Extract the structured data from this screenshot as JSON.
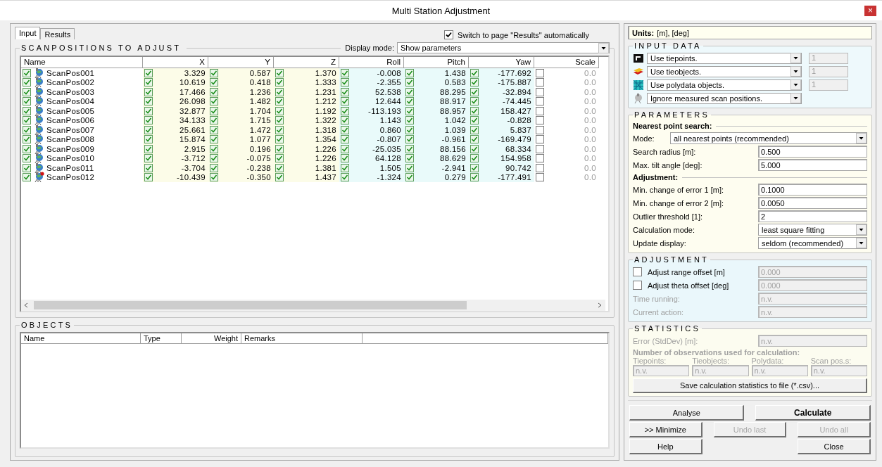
{
  "window": {
    "title": "Multi Station Adjustment",
    "close": "×"
  },
  "tabs": [
    {
      "label": "Input",
      "selected": true
    },
    {
      "label": "Results",
      "selected": false
    }
  ],
  "auto_switch": {
    "label": "Switch to page \"Results\" automatically",
    "checked": true
  },
  "scanpositions": {
    "title": "SCANPOSITIONS TO ADJUST",
    "display_mode": {
      "label": "Display mode:",
      "value": "Show parameters"
    },
    "columns": [
      "Name",
      "X",
      "Y",
      "Z",
      "Roll",
      "Pitch",
      "Yaw",
      "Scale"
    ],
    "rows": [
      {
        "cells": [
          {
            "checked": true,
            "kind": "normal",
            "value": "ScanPos001"
          },
          {
            "checked": true,
            "value": "3.329"
          },
          {
            "checked": true,
            "value": "0.587"
          },
          {
            "checked": true,
            "value": "1.370"
          },
          {
            "checked": true,
            "value": "-0.008"
          },
          {
            "checked": true,
            "value": "1.438"
          },
          {
            "checked": true,
            "value": "-177.692"
          },
          {
            "checked": false,
            "value": "0.0"
          }
        ]
      },
      {
        "cells": [
          {
            "checked": true,
            "kind": "normal",
            "value": "ScanPos002"
          },
          {
            "checked": true,
            "value": "10.619"
          },
          {
            "checked": true,
            "value": "0.418"
          },
          {
            "checked": true,
            "value": "1.333"
          },
          {
            "checked": true,
            "value": "-2.355"
          },
          {
            "checked": true,
            "value": "0.583"
          },
          {
            "checked": true,
            "value": "-175.887"
          },
          {
            "checked": false,
            "value": "0.0"
          }
        ]
      },
      {
        "cells": [
          {
            "checked": true,
            "kind": "normal",
            "value": "ScanPos003"
          },
          {
            "checked": true,
            "value": "17.466"
          },
          {
            "checked": true,
            "value": "1.236"
          },
          {
            "checked": true,
            "value": "1.231"
          },
          {
            "checked": true,
            "value": "52.538"
          },
          {
            "checked": true,
            "value": "88.295"
          },
          {
            "checked": true,
            "value": "-32.894"
          },
          {
            "checked": false,
            "value": "0.0"
          }
        ]
      },
      {
        "cells": [
          {
            "checked": true,
            "kind": "normal",
            "value": "ScanPos004"
          },
          {
            "checked": true,
            "value": "26.098"
          },
          {
            "checked": true,
            "value": "1.482"
          },
          {
            "checked": true,
            "value": "1.212"
          },
          {
            "checked": true,
            "value": "12.644"
          },
          {
            "checked": true,
            "value": "88.917"
          },
          {
            "checked": true,
            "value": "-74.445"
          },
          {
            "checked": false,
            "value": "0.0"
          }
        ]
      },
      {
        "cells": [
          {
            "checked": true,
            "kind": "normal",
            "value": "ScanPos005"
          },
          {
            "checked": true,
            "value": "32.877"
          },
          {
            "checked": true,
            "value": "1.704"
          },
          {
            "checked": true,
            "value": "1.192"
          },
          {
            "checked": true,
            "value": "-113.193"
          },
          {
            "checked": true,
            "value": "88.957"
          },
          {
            "checked": true,
            "value": "158.427"
          },
          {
            "checked": false,
            "value": "0.0"
          }
        ]
      },
      {
        "cells": [
          {
            "checked": true,
            "kind": "normal",
            "value": "ScanPos006"
          },
          {
            "checked": true,
            "value": "34.133"
          },
          {
            "checked": true,
            "value": "1.715"
          },
          {
            "checked": true,
            "value": "1.322"
          },
          {
            "checked": true,
            "value": "1.143"
          },
          {
            "checked": true,
            "value": "1.042"
          },
          {
            "checked": true,
            "value": "-0.828"
          },
          {
            "checked": false,
            "value": "0.0"
          }
        ]
      },
      {
        "cells": [
          {
            "checked": true,
            "kind": "normal",
            "value": "ScanPos007"
          },
          {
            "checked": true,
            "value": "25.661"
          },
          {
            "checked": true,
            "value": "1.472"
          },
          {
            "checked": true,
            "value": "1.318"
          },
          {
            "checked": true,
            "value": "0.860"
          },
          {
            "checked": true,
            "value": "1.039"
          },
          {
            "checked": true,
            "value": "5.837"
          },
          {
            "checked": false,
            "value": "0.0"
          }
        ]
      },
      {
        "cells": [
          {
            "checked": true,
            "kind": "normal",
            "value": "ScanPos008"
          },
          {
            "checked": true,
            "value": "15.874"
          },
          {
            "checked": true,
            "value": "1.077"
          },
          {
            "checked": true,
            "value": "1.354"
          },
          {
            "checked": true,
            "value": "-0.807"
          },
          {
            "checked": true,
            "value": "-0.961"
          },
          {
            "checked": true,
            "value": "-169.479"
          },
          {
            "checked": false,
            "value": "0.0"
          }
        ]
      },
      {
        "cells": [
          {
            "checked": true,
            "kind": "normal",
            "value": "ScanPos009"
          },
          {
            "checked": true,
            "value": "2.915"
          },
          {
            "checked": true,
            "value": "0.196"
          },
          {
            "checked": true,
            "value": "1.226"
          },
          {
            "checked": true,
            "value": "-25.035"
          },
          {
            "checked": true,
            "value": "88.156"
          },
          {
            "checked": true,
            "value": "68.334"
          },
          {
            "checked": false,
            "value": "0.0"
          }
        ]
      },
      {
        "cells": [
          {
            "checked": true,
            "kind": "normal",
            "value": "ScanPos010"
          },
          {
            "checked": true,
            "value": "-3.712"
          },
          {
            "checked": true,
            "value": "-0.075"
          },
          {
            "checked": true,
            "value": "1.226"
          },
          {
            "checked": true,
            "value": "64.128"
          },
          {
            "checked": true,
            "value": "88.629"
          },
          {
            "checked": true,
            "value": "154.958"
          },
          {
            "checked": false,
            "value": "0.0"
          }
        ]
      },
      {
        "cells": [
          {
            "checked": true,
            "kind": "normal",
            "value": "ScanPos011"
          },
          {
            "checked": true,
            "value": "-3.704"
          },
          {
            "checked": true,
            "value": "-0.238"
          },
          {
            "checked": true,
            "value": "1.381"
          },
          {
            "checked": true,
            "value": "1.505"
          },
          {
            "checked": true,
            "value": "-2.941"
          },
          {
            "checked": true,
            "value": "90.742"
          },
          {
            "checked": false,
            "value": "0.0"
          }
        ]
      },
      {
        "cells": [
          {
            "checked": true,
            "kind": "flagged",
            "value": "ScanPos012"
          },
          {
            "checked": true,
            "value": "-10.439"
          },
          {
            "checked": true,
            "value": "-0.350"
          },
          {
            "checked": true,
            "value": "1.437"
          },
          {
            "checked": true,
            "value": "-1.324"
          },
          {
            "checked": true,
            "value": "0.279"
          },
          {
            "checked": true,
            "value": "-177.491"
          },
          {
            "checked": false,
            "value": "0.0"
          }
        ]
      }
    ]
  },
  "objects": {
    "title": "OBJECTS",
    "columns": [
      "Name",
      "Type",
      "Weight",
      "Remarks"
    ]
  },
  "units": {
    "label": "Units:",
    "value": "[m], [deg]"
  },
  "input_data": {
    "title": "INPUT DATA",
    "rows": [
      {
        "kind": "tiepoints",
        "value": "Use tiepoints.",
        "count": "1"
      },
      {
        "kind": "tieobjects",
        "value": "Use tieobjects.",
        "count": "1"
      },
      {
        "kind": "polydata",
        "value": "Use polydata objects.",
        "count": "1"
      },
      {
        "kind": "scanpos",
        "value": "Ignore measured scan positions."
      }
    ]
  },
  "parameters": {
    "title": "PARAMETERS",
    "items": [
      {
        "kind": "heading",
        "label": "Nearest point search:"
      },
      {
        "kind": "wide_select",
        "label": "Mode:",
        "value": "all nearest points (recommended)"
      },
      {
        "kind": "field",
        "label": "Search radius [m]:",
        "value": "0.500"
      },
      {
        "kind": "field",
        "label": "Max. tilt angle [deg]:",
        "value": "5.000"
      },
      {
        "kind": "heading",
        "label": "Adjustment:"
      },
      {
        "kind": "field",
        "label": "Min. change of error 1 [m]:",
        "value": "0.1000"
      },
      {
        "kind": "field",
        "label": "Min. change of error 2 [m]:",
        "value": "0.0050"
      },
      {
        "kind": "field",
        "label": "Outlier threshold [1]:",
        "value": "2"
      },
      {
        "kind": "select",
        "label": "Calculation mode:",
        "value": "least square fitting"
      },
      {
        "kind": "select",
        "label": "Update display:",
        "value": "seldom (recommended)"
      }
    ]
  },
  "adjustment": {
    "title": "ADJUSTMENT",
    "items": [
      {
        "kind": "check",
        "label": "Adjust range offset [m]",
        "checked": false,
        "value": "0.000"
      },
      {
        "kind": "check",
        "label": "Adjust theta offset [deg]",
        "checked": false,
        "value": "0.000"
      },
      {
        "kind": "readout",
        "label": "Time running:",
        "value": "n.v."
      },
      {
        "kind": "readout",
        "label": "Current action:",
        "value": "n.v."
      }
    ]
  },
  "statistics": {
    "title": "STATISTICS",
    "disabled": true,
    "error": {
      "label": "Error (StdDev) [m]:",
      "value": "n.v."
    },
    "observations_heading": "Number of observations used for calculation:",
    "counts": [
      {
        "label": "Tiepoints:",
        "value": "n.v."
      },
      {
        "label": "Tieobjects:",
        "value": "n.v."
      },
      {
        "label": "Polydata:",
        "value": "n.v."
      },
      {
        "label": "Scan pos.s:",
        "value": "n.v."
      }
    ],
    "save_button": "Save calculation statistics to file (*.csv)..."
  },
  "buttons": [
    {
      "label": "Analyse",
      "default": false,
      "disabled": false
    },
    {
      "label": "Calculate",
      "default": true,
      "disabled": false
    },
    {
      "label": ">> Minimize",
      "default": false,
      "disabled": false
    },
    {
      "label": "Undo last",
      "default": false,
      "disabled": true
    },
    {
      "label": "Undo all",
      "default": false,
      "disabled": true
    },
    {
      "label": "Help",
      "default": false,
      "disabled": false
    },
    {
      "label": "Close",
      "default": false,
      "disabled": false
    }
  ]
}
